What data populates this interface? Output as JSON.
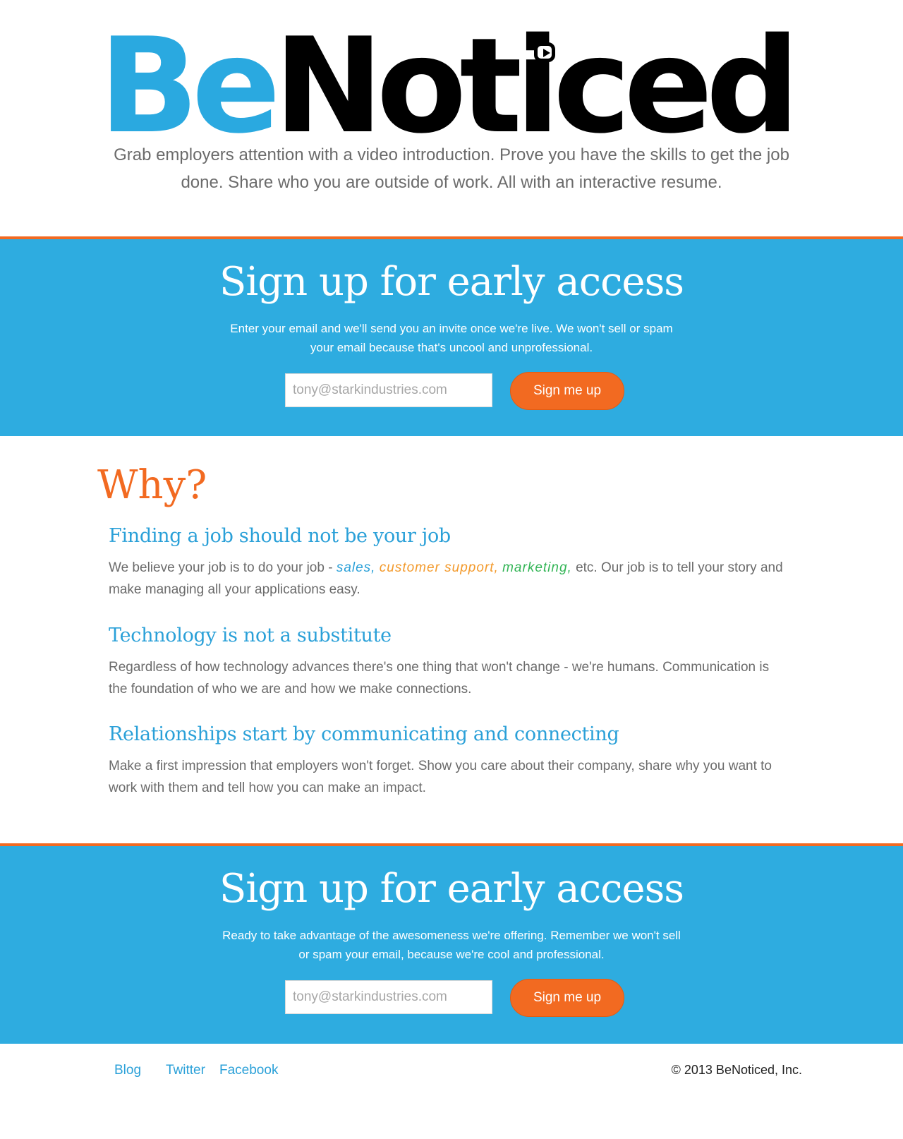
{
  "logo": {
    "part1": "Be",
    "part2": "Noticed"
  },
  "tagline": "Grab employers attention with a video introduction. Prove you have the skills to get the job done. Share who you are outside of work. All with an interactive resume.",
  "signup_top": {
    "heading": "Sign up for early access",
    "description": "Enter your email and we'll send you an invite once we're live. We won't sell or spam your email because that's uncool and unprofessional.",
    "email_placeholder": "tony@starkindustries.com",
    "button_label": "Sign me up"
  },
  "why": {
    "title": "Why?",
    "reasons": [
      {
        "heading": "Finding a job should not be your job",
        "text_before": "We believe your job is to do your job - ",
        "highlights": [
          "sales,",
          "customer support,",
          "marketing,"
        ],
        "text_after": " etc. Our job is to tell your story and make managing all your applications easy."
      },
      {
        "heading": "Technology is not a substitute",
        "text": "Regardless of how technology advances there's one thing that won't change - we're humans. Communication is the foundation of who we are and how we make connections."
      },
      {
        "heading": "Relationships start by communicating and connecting",
        "text": "Make a first impression that employers won't forget. Show you care about their company, share why you want to work with them and tell how you can make an impact."
      }
    ]
  },
  "signup_bottom": {
    "heading": "Sign up for early access",
    "description": "Ready to take advantage of the awesomeness we're offering. Remember we won't sell or spam your email, because we're cool and professional.",
    "email_placeholder": "tony@starkindustries.com",
    "button_label": "Sign me up"
  },
  "footer": {
    "links": [
      "Blog",
      "Twitter",
      "Facebook"
    ],
    "copyright": "© 2013 BeNoticed, Inc."
  },
  "colors": {
    "brand_blue": "#2eace0",
    "accent_orange": "#f26a21",
    "highlight_sales": "#2aa0d8",
    "highlight_support": "#f39a2c",
    "highlight_marketing": "#33b556"
  }
}
